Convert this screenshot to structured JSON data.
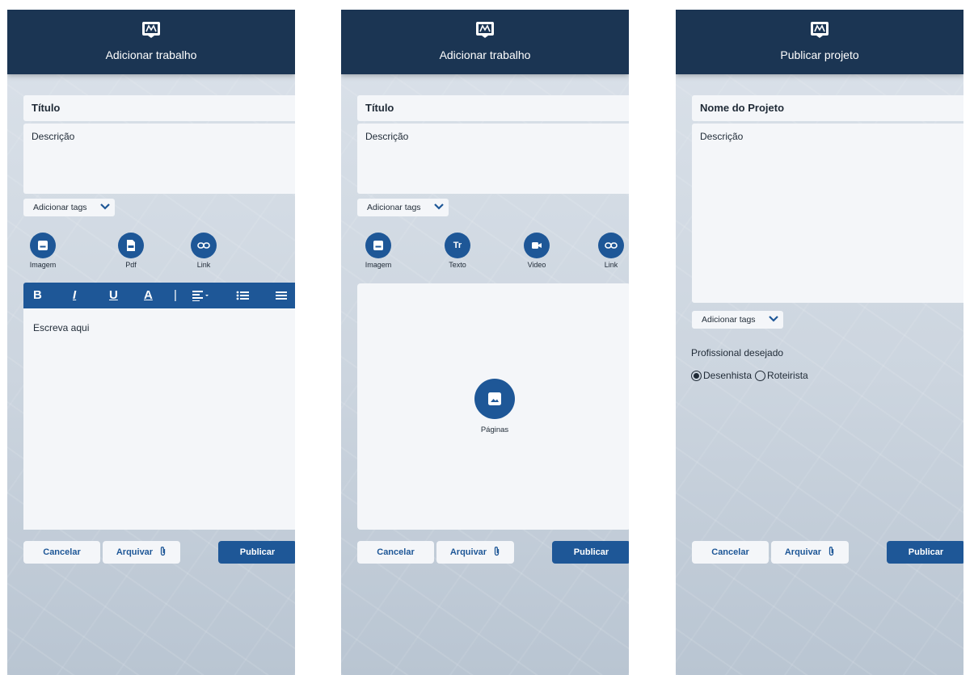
{
  "screens": [
    {
      "header_title": "Adicionar trabalho",
      "title_field": "Título",
      "description_field": "Descrição",
      "tags_label": "Adicionar tags",
      "media": [
        {
          "label": "Imagem",
          "icon": "image-icon"
        },
        {
          "label": "Pdf",
          "icon": "pdf-icon"
        },
        {
          "label": "Link",
          "icon": "link-icon"
        }
      ],
      "toolbar": [
        "B",
        "I",
        "U",
        "A",
        "|"
      ],
      "editor_placeholder": "Escreva aqui",
      "buttons": {
        "cancel": "Cancelar",
        "archive": "Arquivar",
        "publish": "Publicar"
      }
    },
    {
      "header_title": "Adicionar trabalho",
      "title_field": "Título",
      "description_field": "Descrição",
      "tags_label": "Adicionar tags",
      "media": [
        {
          "label": "Imagem",
          "icon": "image-icon"
        },
        {
          "label": "Texto",
          "icon": "text-icon"
        },
        {
          "label": "Video",
          "icon": "video-icon"
        },
        {
          "label": "Link",
          "icon": "link-icon"
        }
      ],
      "pages_label": "Páginas",
      "buttons": {
        "cancel": "Cancelar",
        "archive": "Arquivar",
        "publish": "Publicar"
      }
    },
    {
      "header_title": "Publicar projeto",
      "title_field": "Nome do Projeto",
      "description_field": "Descrição",
      "tags_label": "Adicionar tags",
      "professional_label": "Profissional desejado",
      "radio_options": [
        {
          "label": "Desenhista",
          "selected": true
        },
        {
          "label": "Roteirista",
          "selected": false
        }
      ],
      "buttons": {
        "cancel": "Cancelar",
        "archive": "Arquivar",
        "publish": "Publicar"
      }
    }
  ],
  "colors": {
    "header": "#1b3553",
    "accent": "#1e5797",
    "field": "#f4f6f9"
  }
}
